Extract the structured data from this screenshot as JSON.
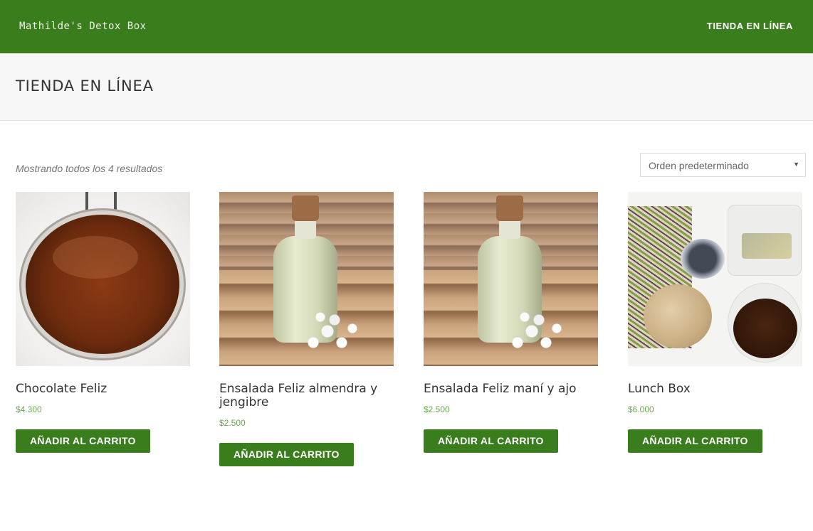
{
  "header": {
    "brand": "Mathilde's Detox Box",
    "nav_item": "TIENDA EN LÍNEA",
    "accent_color": "#3a7d1c"
  },
  "page": {
    "title": "TIENDA EN LÍNEA"
  },
  "shop": {
    "result_count": "Mostrando todos los 4 resultados",
    "ordering": {
      "selected": "Orden predeterminado",
      "arrow_icon": "chevron-down-icon"
    }
  },
  "products": [
    {
      "name": "Chocolate Feliz",
      "price": "$4.300",
      "button": "AÑADIR AL CARRITO",
      "image": "chocolate-jar"
    },
    {
      "name": "Ensalada Feliz almendra y jengibre",
      "price": "$2.500",
      "button": "AÑADIR AL CARRITO",
      "image": "green-bottle"
    },
    {
      "name": "Ensalada Feliz maní y ajo",
      "price": "$2.500",
      "button": "AÑADIR AL CARRITO",
      "image": "green-bottle"
    },
    {
      "name": "Lunch Box",
      "price": "$6.000",
      "button": "AÑADIR AL CARRITO",
      "image": "lunch-box"
    }
  ]
}
